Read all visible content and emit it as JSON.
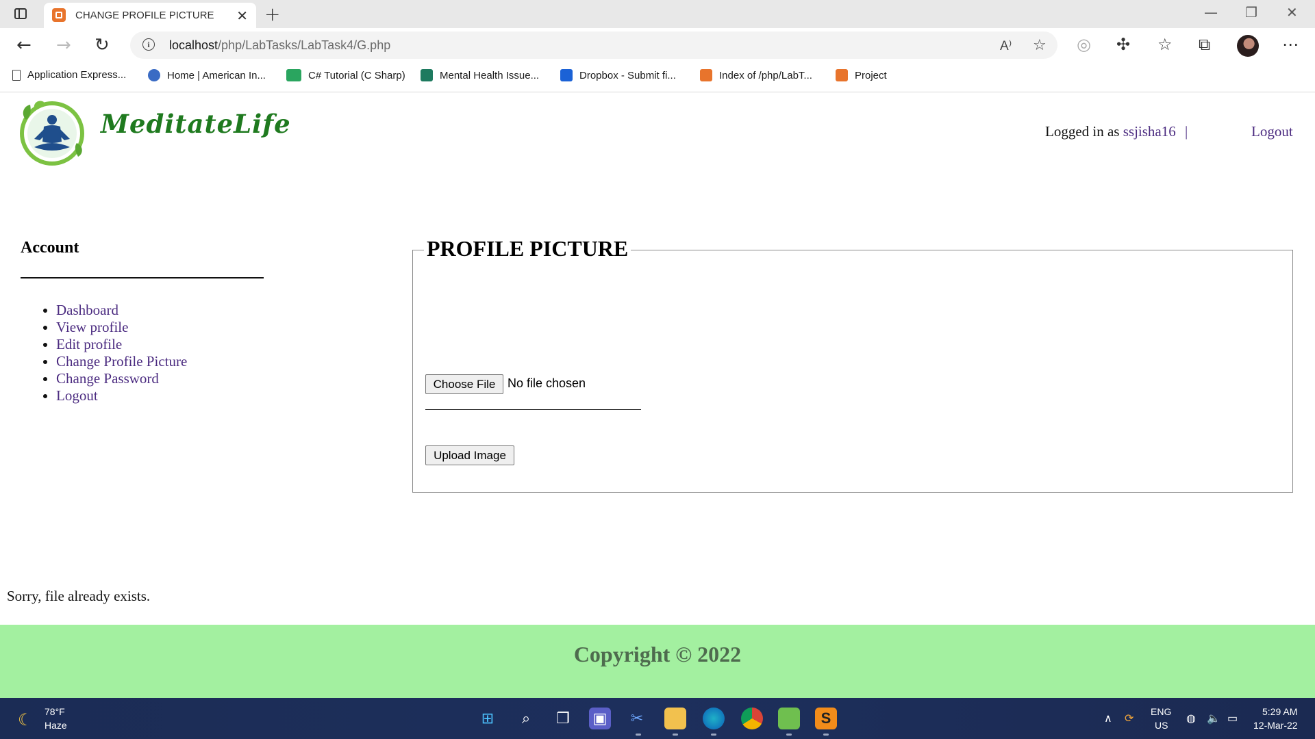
{
  "browser": {
    "tab_title": "CHANGE PROFILE PICTURE",
    "tab_close": "✕",
    "new_tab": "+",
    "url_host": "localhost",
    "url_path": "/php/LabTasks/LabTask4/G.php",
    "bookmarks": [
      {
        "label": "Application Express...",
        "icon": "page-icon"
      },
      {
        "label": "Home | American In...",
        "icon": "globe-icon"
      },
      {
        "label": "C# Tutorial (C Sharp)",
        "icon": "w3-icon"
      },
      {
        "label": "Mental Health Issue...",
        "icon": "sheet-icon"
      },
      {
        "label": "Dropbox - Submit fi...",
        "icon": "dropbox-icon"
      },
      {
        "label": "Index of /php/LabT...",
        "icon": "xampp-icon"
      },
      {
        "label": "Project",
        "icon": "xampp-icon"
      }
    ]
  },
  "site": {
    "brand": "MeditateLife",
    "logged_in_prefix": "Logged in as ",
    "username": "ssjisha16",
    "separator": "|",
    "logout": "Logout"
  },
  "sidebar": {
    "heading": "Account",
    "items": [
      {
        "label": "Dashboard"
      },
      {
        "label": "View profile"
      },
      {
        "label": "Edit profile"
      },
      {
        "label": "Change Profile Picture"
      },
      {
        "label": "Change Password"
      },
      {
        "label": "Logout"
      }
    ]
  },
  "form": {
    "legend": "PROFILE PICTURE",
    "choose_file": "Choose File",
    "file_status": "No file chosen",
    "upload": "Upload Image"
  },
  "message": "Sorry, file already exists.",
  "footer": {
    "text": "Copyright © 2022"
  },
  "taskbar": {
    "temp": "78°F",
    "condition": "Haze",
    "lang_line1": "ENG",
    "lang_line2": "US",
    "time": "5:29 AM",
    "date": "12-Mar-22"
  },
  "colors": {
    "link": "#4b2b80",
    "footer_bg": "#a3f0a0",
    "brand": "#1f7a1f",
    "taskbar": "#1d2f5c"
  }
}
